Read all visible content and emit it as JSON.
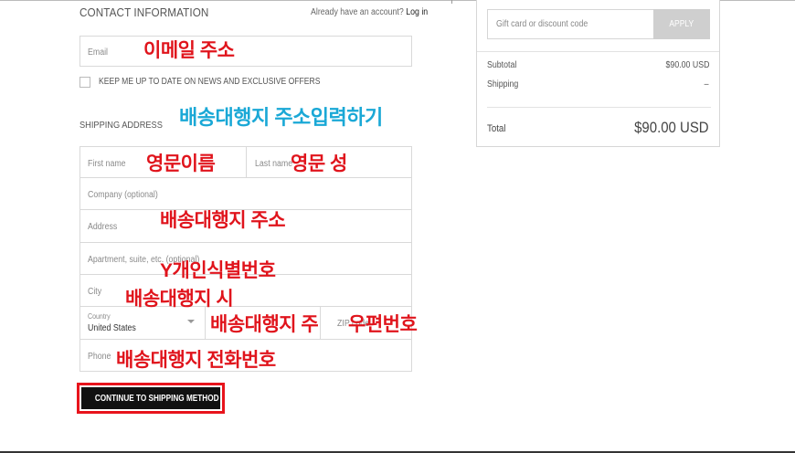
{
  "contact": {
    "title": "CONTACT INFORMATION",
    "account_prompt": "Already have an account?",
    "login_link": "Log in",
    "email_placeholder": "Email",
    "newsletter_label": "KEEP ME UP TO DATE ON NEWS AND EXCLUSIVE OFFERS"
  },
  "shipping": {
    "title": "SHIPPING ADDRESS",
    "first_name_placeholder": "First name",
    "last_name_placeholder": "Last name",
    "company_placeholder": "Company (optional)",
    "address_placeholder": "Address",
    "apartment_placeholder": "Apartment, suite, etc. (optional)",
    "city_placeholder": "City",
    "country_label": "Country",
    "country_value": "United States",
    "zip_placeholder": "ZIP code",
    "phone_placeholder": "Phone"
  },
  "actions": {
    "continue_label": "CONTINUE TO SHIPPING METHOD"
  },
  "summary": {
    "gift_placeholder": "Gift card or discount code",
    "apply_label": "APPLY",
    "subtotal_label": "Subtotal",
    "subtotal_value": "$90.00 USD",
    "shipping_label": "Shipping",
    "shipping_value": "–",
    "total_label": "Total",
    "total_value": "$90.00 USD"
  },
  "annotations": {
    "email": "이메일 주소",
    "shipping_title": "배송대행지 주소입력하기",
    "first_name": "영문이름",
    "last_name": "영문 성",
    "address": "배송대행지 주소",
    "apartment": "Y개인식별번호",
    "city": "배송대행지 시",
    "state": "배송대행지 주",
    "zip": "우편번호",
    "phone": "배송대행지 전화번호"
  },
  "colors": {
    "annotation_red": "#e0141c",
    "annotation_blue": "#1aa8d6",
    "button_black": "#111111",
    "highlight_border": "#e8141c"
  }
}
